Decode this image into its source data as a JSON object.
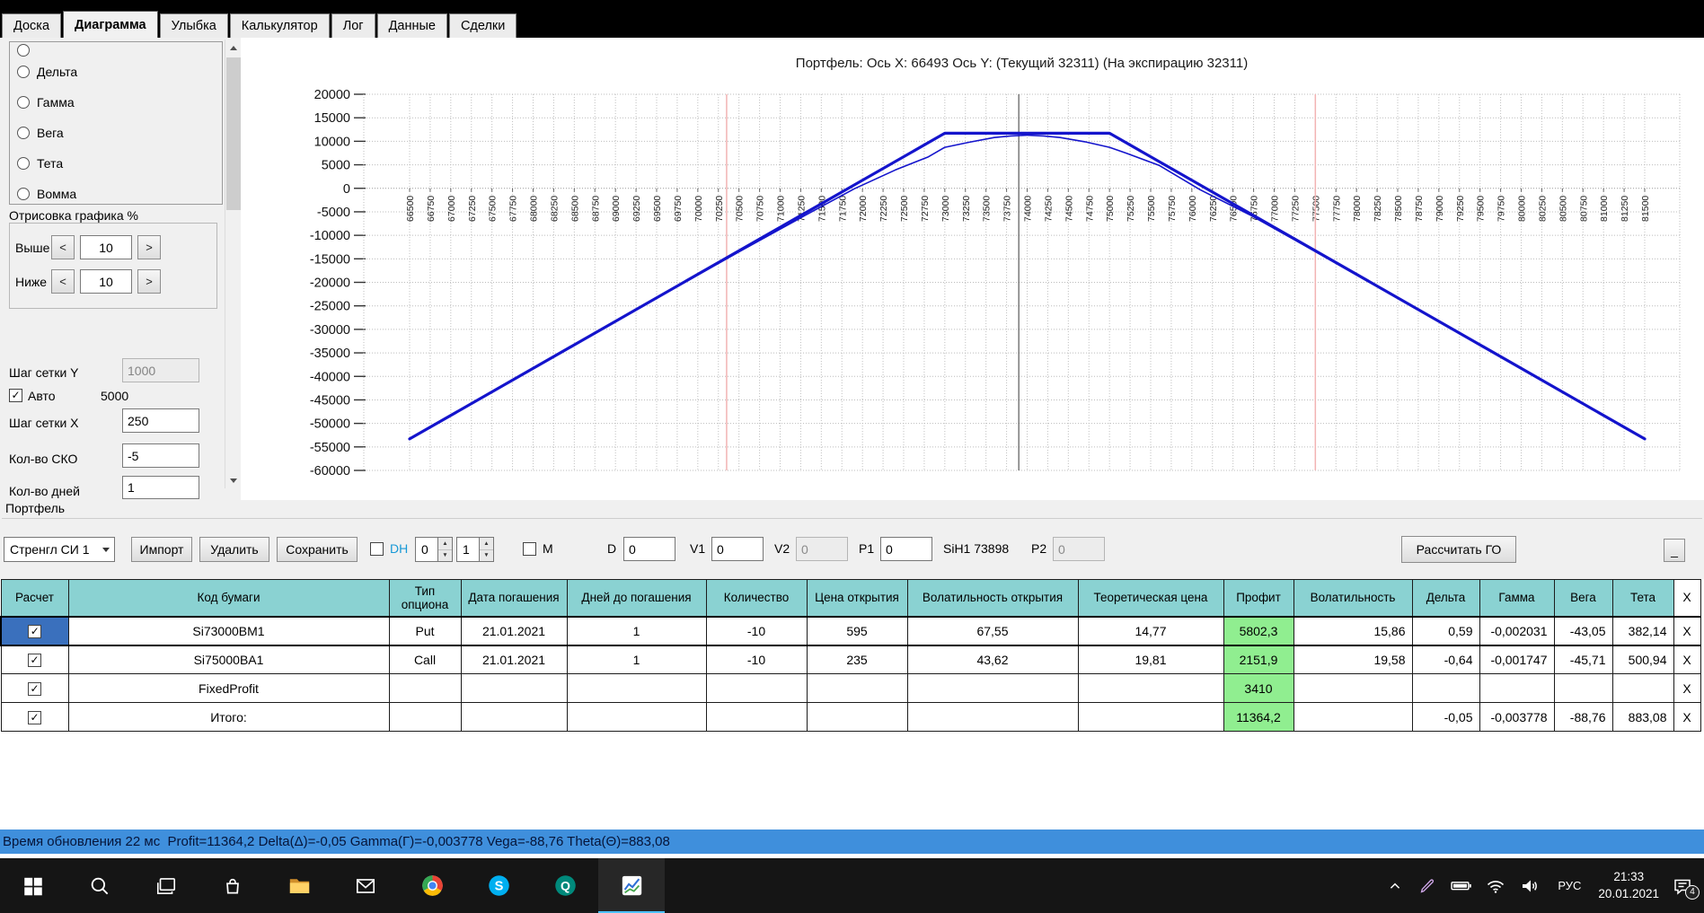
{
  "tabs": {
    "active": "Диаграмма",
    "items": [
      {
        "label": "Доска",
        "slug": "board"
      },
      {
        "label": "Диаграмма",
        "slug": "diagram"
      },
      {
        "label": "Улыбка",
        "slug": "smile"
      },
      {
        "label": "Калькулятор",
        "slug": "calculator"
      },
      {
        "label": "Лог",
        "slug": "log"
      },
      {
        "label": "Данные",
        "slug": "data"
      },
      {
        "label": "Сделки",
        "slug": "trades"
      }
    ]
  },
  "left_panel": {
    "greek_options": [
      {
        "label": "Дельта",
        "slug": "delta",
        "selected": false
      },
      {
        "label": "Гамма",
        "slug": "gamma",
        "selected": false
      },
      {
        "label": "Вега",
        "slug": "vega",
        "selected": false
      },
      {
        "label": "Тета",
        "slug": "theta",
        "selected": false
      },
      {
        "label": "Вомма",
        "slug": "vomma",
        "selected": false
      }
    ],
    "draw_group": {
      "title": "Отрисовка графика %",
      "rows": [
        {
          "label": "Выше",
          "value": "10"
        },
        {
          "label": "Ниже",
          "value": "10"
        }
      ]
    },
    "grid_step_y": {
      "label": "Шаг сетки Y",
      "value": "1000",
      "auto_label": "Авто",
      "auto_checked": true,
      "auto_value": "5000"
    },
    "grid_step_x": {
      "label": "Шаг сетки X",
      "value": "250"
    },
    "sko": {
      "label": "Кол-во СКО",
      "value": "-5"
    },
    "days": {
      "label": "Кол-во дней",
      "value": "1"
    }
  },
  "chart_data": {
    "type": "line",
    "title": "Портфель: Ось X: 66493 Ось Y:  (Текущий 32311)  (На экспирацию 32311)",
    "x_axis": {
      "min": 66500,
      "max": 81500,
      "tick_step": 250
    },
    "y_axis": {
      "min": -60000,
      "max": 20000,
      "tick_step": 5000
    },
    "grid": "dotted",
    "vertical_markers": [
      {
        "x": 70350,
        "color": "#f2b3b3",
        "name": "lower-sko-bound"
      },
      {
        "x": 77500,
        "color": "#f2b3b3",
        "name": "upper-sko-bound"
      },
      {
        "x": 73898,
        "color": "#4a4a4a",
        "name": "current-price"
      }
    ],
    "series": [
      {
        "name": "expiration",
        "color": "#1414cc",
        "width": 3.2,
        "points": [
          [
            66500,
            -53290
          ],
          [
            73000,
            11710
          ],
          [
            75000,
            11710
          ],
          [
            81500,
            -53290
          ]
        ]
      },
      {
        "name": "current",
        "color": "#1414cc",
        "width": 1.6,
        "points": [
          [
            66500,
            -53290
          ],
          [
            68000,
            -38300
          ],
          [
            69500,
            -23350
          ],
          [
            70500,
            -13500
          ],
          [
            71300,
            -5800
          ],
          [
            71900,
            -100
          ],
          [
            72400,
            3900
          ],
          [
            72800,
            6700
          ],
          [
            73000,
            8710
          ],
          [
            73300,
            9800
          ],
          [
            73600,
            10800
          ],
          [
            73800,
            11150
          ],
          [
            74000,
            11300
          ],
          [
            74200,
            11150
          ],
          [
            74400,
            10800
          ],
          [
            74700,
            9900
          ],
          [
            75000,
            8710
          ],
          [
            75200,
            7500
          ],
          [
            75600,
            4900
          ],
          [
            76100,
            -300
          ],
          [
            76700,
            -5600
          ],
          [
            77400,
            -12450
          ],
          [
            78500,
            -23400
          ],
          [
            80000,
            -38350
          ],
          [
            81500,
            -53290
          ]
        ]
      }
    ]
  },
  "portfolio": {
    "section_title": "Портфель",
    "strategy_select": "Стренгл СИ 1",
    "import_button": "Импорт",
    "delete_button": "Удалить",
    "save_button": "Сохранить",
    "dh": {
      "label": "DH",
      "checked": false,
      "spin1": "0",
      "spin2": "1"
    },
    "m": {
      "label": "M",
      "checked": false
    },
    "params": [
      {
        "label": "D",
        "value": "0"
      },
      {
        "label": "V1",
        "value": "0"
      },
      {
        "label": "V2",
        "value": "0",
        "disabled": true
      },
      {
        "label": "P1",
        "value": "0"
      }
    ],
    "instrument": "SiH1 73898",
    "p2": {
      "label": "P2",
      "value": "0",
      "disabled": true
    },
    "calc_go_button": "Рассчитать ГО",
    "collapse_button": "_"
  },
  "table": {
    "colors": {
      "header_bg": "#8ad2d2",
      "profit_bg": "#90ee90",
      "selected_row_accent": "#3a70bd"
    },
    "headers": [
      "Расчет",
      "Код бумаги",
      "Тип опциона",
      "Дата погашения",
      "Дней до погашения",
      "Количество",
      "Цена открытия",
      "Волатильность открытия",
      "Теоретическая цена",
      "Профит",
      "Волатильность",
      "Дельта",
      "Гамма",
      "Вега",
      "Тета",
      "X"
    ],
    "rows": [
      {
        "checked": true,
        "selected": true,
        "cells": [
          "Si73000BM1",
          "Put",
          "21.01.2021",
          "1",
          "-10",
          "595",
          "67,55",
          "14,77",
          "5802,3",
          "15,86",
          "0,59",
          "-0,002031",
          "-43,05",
          "382,14"
        ],
        "delete_label": "X"
      },
      {
        "checked": true,
        "cells": [
          "Si75000BA1",
          "Call",
          "21.01.2021",
          "1",
          "-10",
          "235",
          "43,62",
          "19,81",
          "2151,9",
          "19,58",
          "-0,64",
          "-0,001747",
          "-45,71",
          "500,94"
        ],
        "delete_label": "X"
      },
      {
        "checked": true,
        "cells": [
          "FixedProfit",
          "",
          "",
          "",
          "",
          "",
          "",
          "",
          "3410",
          "",
          "",
          "",
          "",
          ""
        ],
        "delete_label": "X"
      },
      {
        "checked": true,
        "cells": [
          "Итого:",
          "",
          "",
          "",
          "",
          "",
          "",
          "",
          "11364,2",
          "",
          "-0,05",
          "-0,003778",
          "-88,76",
          "883,08"
        ],
        "delete_label": "X"
      }
    ]
  },
  "status_bar": {
    "background": "#3f8fdc",
    "text": "Время обновления 22 мс  Profit=11364,2 Delta(Δ)=-0,05 Gamma(Γ)=-0,003778 Vega=-88,76 Theta(Θ)=883,08"
  },
  "taskbar": {
    "pinned_icons": [
      "start",
      "search",
      "task-view",
      "store",
      "file-explorer",
      "mail",
      "chrome",
      "skype",
      "quik",
      "chart-app"
    ],
    "active_app": "chart-app",
    "tray_icons": [
      "chevron-up",
      "pen",
      "battery",
      "wifi",
      "volume"
    ],
    "language": "РУС",
    "time": "21:33",
    "date": "20.01.2021",
    "notification_count": "4"
  }
}
